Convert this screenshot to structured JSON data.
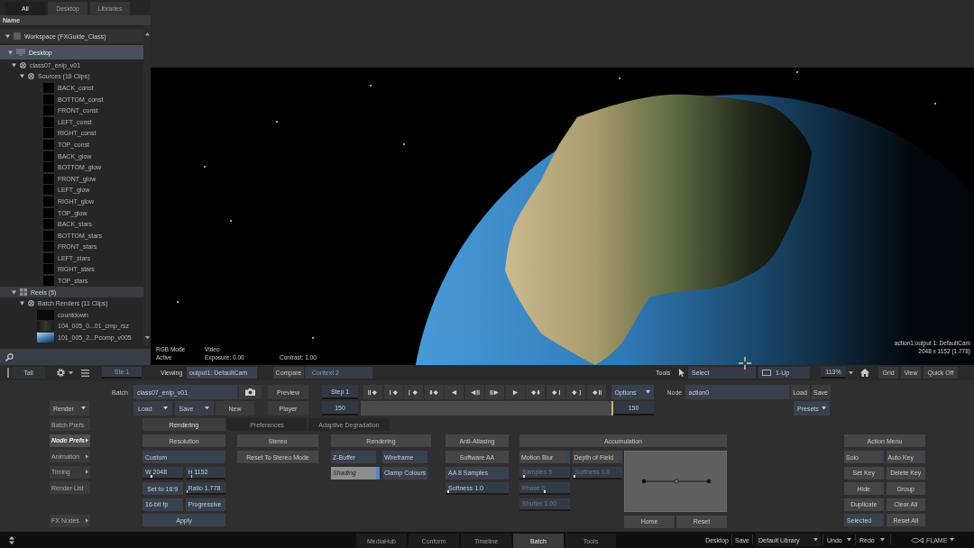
{
  "browser": {
    "tabs": [
      {
        "label": "All",
        "selected": true
      },
      {
        "label": "Desktop",
        "selected": false
      },
      {
        "label": "Libraries",
        "selected": false
      }
    ],
    "column_header": "Name",
    "tree": [
      {
        "label": "Workspace (FXGuide_Class)",
        "kind": "workspace",
        "expanded": true,
        "selected": false,
        "children": [
          {
            "label": "Desktop",
            "kind": "desktop",
            "expanded": true,
            "selected": true,
            "children": [
              {
                "label": "class07_enip_v01",
                "kind": "batch",
                "expanded": true,
                "selected": false,
                "children": [
                  {
                    "label": "Sources (18 Clips)",
                    "kind": "reel",
                    "expanded": true,
                    "selected": false,
                    "children": [
                      {
                        "label": "BACK_const",
                        "kind": "blank",
                        "selected": false
                      },
                      {
                        "label": "BOTTOM_const",
                        "kind": "blank",
                        "selected": false
                      },
                      {
                        "label": "FRONT_const",
                        "kind": "blank",
                        "selected": false
                      },
                      {
                        "label": "LEFT_const",
                        "kind": "blank",
                        "selected": false
                      },
                      {
                        "label": "RIGHT_const",
                        "kind": "blank",
                        "selected": false
                      },
                      {
                        "label": "TOP_const",
                        "kind": "blank",
                        "selected": false
                      },
                      {
                        "label": "BACK_glow",
                        "kind": "blank",
                        "selected": false
                      },
                      {
                        "label": "BOTTOM_glow",
                        "kind": "blank",
                        "selected": false
                      },
                      {
                        "label": "FRONT_glow",
                        "kind": "blank",
                        "selected": false
                      },
                      {
                        "label": "LEFT_glow",
                        "kind": "blank",
                        "selected": false
                      },
                      {
                        "label": "RIGHT_glow",
                        "kind": "blank",
                        "selected": false
                      },
                      {
                        "label": "TOP_glow",
                        "kind": "blank",
                        "selected": false
                      },
                      {
                        "label": "BACK_stars",
                        "kind": "blank",
                        "selected": false
                      },
                      {
                        "label": "BOTTOM_stars",
                        "kind": "blank",
                        "selected": false
                      },
                      {
                        "label": "FRONT_stars",
                        "kind": "blank",
                        "selected": false
                      },
                      {
                        "label": "LEFT_stars",
                        "kind": "blank",
                        "selected": false
                      },
                      {
                        "label": "RIGHT_stars",
                        "kind": "blank",
                        "selected": false
                      },
                      {
                        "label": "TOP_stars",
                        "kind": "blank",
                        "selected": false
                      }
                    ]
                  }
                ]
              },
              {
                "label": "Reels (5)",
                "kind": "group",
                "expanded": true,
                "selected": false,
                "children": [
                  {
                    "label": "Batch Renders (11 Clips)",
                    "kind": "reel",
                    "expanded": true,
                    "selected": false,
                    "children": [
                      {
                        "label": "countdown",
                        "kind": "frame",
                        "selected": false
                      },
                      {
                        "label": "104_005_0...01_cmp_rsz",
                        "kind": "render",
                        "selected": false
                      },
                      {
                        "label": "101_005_2...Pcomp_v005",
                        "kind": "planet",
                        "selected": false
                      }
                    ]
                  }
                ]
              }
            ]
          }
        ]
      }
    ],
    "toolbar": {
      "view_button": "Tall",
      "slot": "Ste 1"
    }
  },
  "viewer": {
    "info": [
      {
        "cells": [
          "RGB Mode",
          "Video"
        ]
      },
      {
        "cells": [
          "Active",
          "Exposure: 0.00",
          "Contrast: 1.00"
        ]
      }
    ],
    "camera_info": [
      "action1:output 1: DefaultCam",
      "2048 x 1152 (1.778)"
    ]
  },
  "viewer_toolbar": {
    "viewing_label": "Viewing",
    "viewing_value": "output1: DefaultCam",
    "compare_button": "Compare",
    "context_value": "Context 2",
    "tools_label": "Tools",
    "tool_value": "Select",
    "layout_value": "1-Up",
    "zoom_value": "113%",
    "buttons": [
      "Grid",
      "View",
      "Quick Off"
    ]
  },
  "batch_controls": {
    "batch_label": "Batch",
    "batch_name": "class07_enip_v01",
    "preview_button": "Preview",
    "step_value": "Step 1",
    "options_button": "Options",
    "node_label": "Node",
    "node_value": "action0",
    "node_buttons": [
      "Load",
      "Save"
    ],
    "render_button": "Render",
    "setup_buttons": [
      {
        "label": "Load",
        "kind": "dropdown"
      },
      {
        "label": "Save",
        "kind": "dropdown"
      },
      {
        "label": "New",
        "kind": "button"
      }
    ],
    "player_button": "Player",
    "start_frame": "150",
    "timeline": {
      "level": 1
    },
    "end_frame": "150",
    "presets_button": "Presets"
  },
  "menu": [
    {
      "label": "Batch Prefs",
      "submenu": false,
      "selected": false
    },
    {
      "label": "Node Prefs",
      "submenu": true,
      "selected": true
    },
    {
      "label": "Animation",
      "submenu": true,
      "selected": false
    },
    {
      "label": "Timing",
      "submenu": true,
      "selected": false
    },
    {
      "label": "Render List",
      "submenu": false,
      "selected": false
    },
    {
      "label": "FX Nodes",
      "submenu": true,
      "selected": false
    }
  ],
  "tabs": [
    {
      "label": "Rendering",
      "selected": true
    },
    {
      "label": "Preferences",
      "selected": false
    },
    {
      "label": "Adaptive Degradation",
      "selected": false
    }
  ],
  "sections": [
    {
      "title": "Resolution",
      "rows": [
        [
          {
            "label": "Custom",
            "kind": "dropdown"
          }
        ],
        [
          {
            "label": "W 2048",
            "kind": "number",
            "level": 0.22
          },
          {
            "label": "H 1152",
            "kind": "number",
            "level": 0.15
          }
        ],
        [
          {
            "label": "Set to 16:9",
            "kind": "action"
          },
          {
            "label": "Ratio 1.778",
            "kind": "number",
            "level": 0.03
          }
        ],
        [
          {
            "label": "16-bit fp",
            "kind": "dropdown"
          },
          {
            "label": "Progressive",
            "kind": "dropdown"
          }
        ],
        [
          {
            "label": "Apply",
            "kind": "action"
          }
        ]
      ]
    },
    {
      "title": "Stereo",
      "rows": [
        [
          {
            "label": "Reset To Stereo Mode",
            "kind": "button"
          }
        ]
      ]
    },
    {
      "title": "Rendering",
      "rows": [
        [
          {
            "label": "Z-Buffer",
            "kind": "mode",
            "on": false
          },
          {
            "label": "Wireframe",
            "kind": "mode",
            "on": false
          }
        ],
        [
          {
            "label": "Shading",
            "kind": "mode",
            "on": true
          },
          {
            "label": "Clamp Colours",
            "kind": "mode",
            "on": false
          }
        ]
      ]
    },
    {
      "title": "Anti-Aliasing",
      "rows": [
        [
          {
            "label": "Software AA",
            "kind": "button"
          }
        ],
        [
          {
            "label": "AA 8 Samples",
            "kind": "dropdown"
          }
        ],
        [
          {
            "label": "Softness 1.0",
            "kind": "number",
            "level": 0.03
          }
        ]
      ]
    },
    {
      "title": "Accumulation",
      "rows": [
        [
          {
            "label": "Motion Blur",
            "kind": "toggle",
            "on": false,
            "disabled": false
          },
          {
            "label": "Depth of Field",
            "kind": "toggle",
            "on": false,
            "disabled": false
          }
        ],
        [
          {
            "label": "Samples 5",
            "kind": "number",
            "level": 0.08,
            "disabled": true
          },
          {
            "label": "Softness 1.0",
            "kind": "number",
            "level": 0.03,
            "disabled": true
          }
        ],
        [
          {
            "label": "Phase 0",
            "kind": "number",
            "level": 0.5,
            "disabled": true
          }
        ],
        [
          {
            "label": "Shutter 1.00",
            "kind": "number",
            "disabled": true
          }
        ]
      ],
      "curve_buttons": [
        "Home",
        "Reset"
      ]
    },
    {
      "title": "Action Menu",
      "rows": [
        [
          {
            "label": "Solo",
            "kind": "toggle",
            "on": false
          },
          {
            "label": "Auto Key",
            "kind": "toggle",
            "on": false
          }
        ],
        [
          {
            "label": "Set Key",
            "kind": "button"
          },
          {
            "label": "Delete Key",
            "kind": "button"
          }
        ],
        [
          {
            "label": "Hide",
            "kind": "button"
          },
          {
            "label": "Group",
            "kind": "button"
          }
        ],
        [
          {
            "label": "Duplicate",
            "kind": "button"
          },
          {
            "label": "Clear All",
            "kind": "button"
          }
        ],
        [
          {
            "label": "Selected",
            "kind": "dropdown"
          },
          {
            "label": "Reset All",
            "kind": "button"
          }
        ]
      ]
    }
  ],
  "bottom_bar": {
    "tabs": [
      {
        "label": "MediaHub",
        "selected": false
      },
      {
        "label": "Conform",
        "selected": false
      },
      {
        "label": "Timeline",
        "selected": false
      },
      {
        "label": "Batch",
        "selected": true
      },
      {
        "label": "Tools",
        "selected": false
      }
    ],
    "desktop_button": "Desktop",
    "save_button": "Save",
    "library_value": "Default Library",
    "undo_button": "Undo",
    "redo_button": "Redo",
    "product": "FLAME"
  }
}
